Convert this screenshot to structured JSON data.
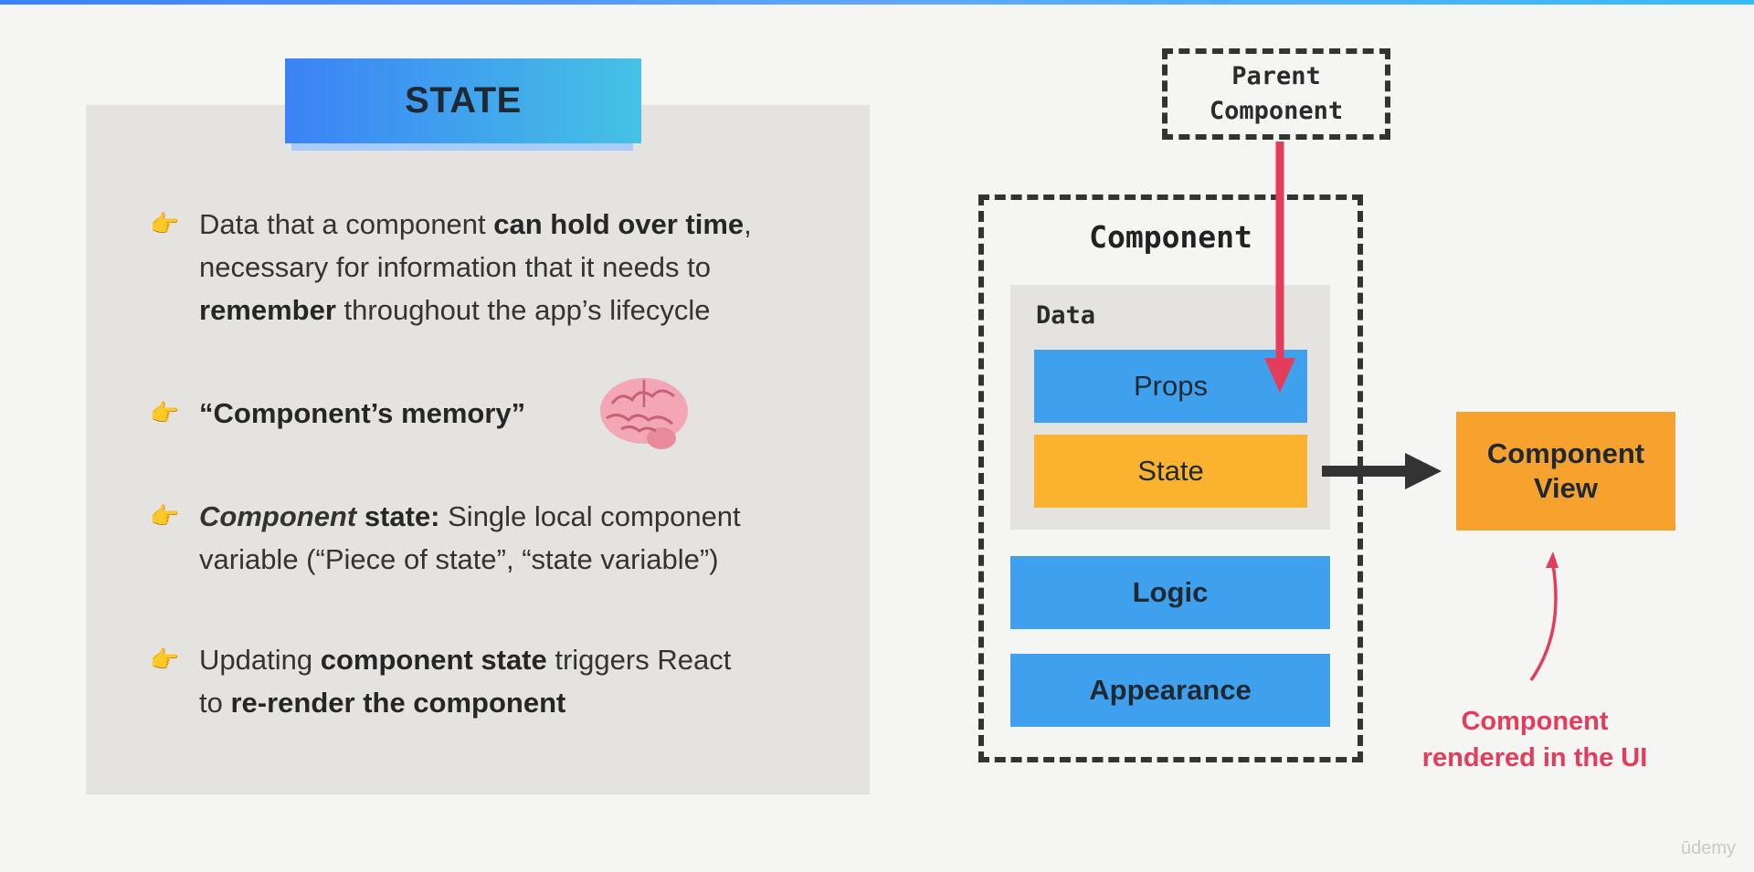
{
  "slide": {
    "title": "STATE",
    "accent_colors": {
      "blue": "#3b82f6",
      "cyan": "#45c2e4",
      "orange": "#fbb22f",
      "red": "#e43d5b"
    }
  },
  "bullets": [
    {
      "icon": "pointing-hand-icon",
      "segments": [
        "Data that a component ",
        "can hold over time",
        ",",
        "necessary for information that it needs to",
        "remember",
        " throughout the app’s lifecycle"
      ]
    },
    {
      "icon": "pointing-hand-icon",
      "segments": [
        "“Component’s memory”"
      ]
    },
    {
      "icon": "pointing-hand-icon",
      "segments": [
        "Component",
        " state:",
        " Single local component",
        "variable (“Piece of state”, “state variable”)"
      ]
    },
    {
      "icon": "pointing-hand-icon",
      "segments": [
        "Updating ",
        "component state",
        " triggers React",
        "to ",
        "re-render the component"
      ]
    }
  ],
  "brain_icon": "brain-icon",
  "diagram": {
    "parent": "Parent\nComponent",
    "component": "Component",
    "data": "Data",
    "props": "Props",
    "state": "State",
    "logic": "Logic",
    "appearance": "Appearance",
    "view": "Component\nView",
    "rendered": "Component\nrendered in the UI"
  },
  "watermark": "ūdemy"
}
